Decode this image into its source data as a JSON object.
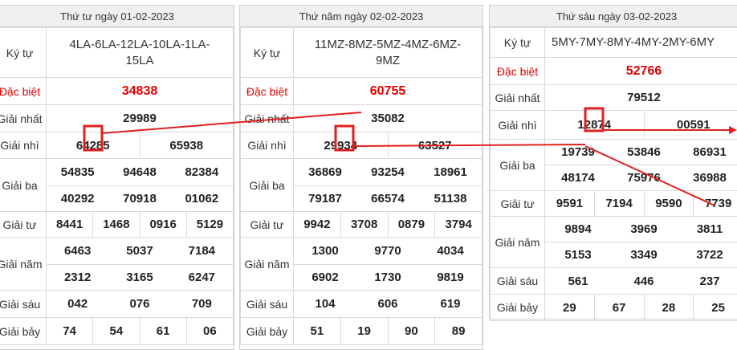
{
  "panels": [
    {
      "header": "Thứ tư ngày 01-02-2023",
      "labels": {
        "kytu": "Ký tự",
        "db": "Đặc biệt",
        "g1": "Giải nhất",
        "g2": "Giải nhì",
        "g3": "Giải ba",
        "g4": "Giải tư",
        "g5": "Giải năm",
        "g6": "Giải sáu",
        "g7": "Giải bảy"
      },
      "kytu": "4LA-6LA-12LA-10LA-1LA-15LA",
      "db": "34838",
      "g1": "29989",
      "g2": [
        "64285",
        "65938"
      ],
      "g3": [
        "54835",
        "94648",
        "82384",
        "40292",
        "70918",
        "01062"
      ],
      "g4": [
        "8441",
        "1468",
        "0916",
        "5129"
      ],
      "g5": [
        "6463",
        "5037",
        "7184",
        "2312",
        "3165",
        "6247"
      ],
      "g6": [
        "042",
        "076",
        "709"
      ],
      "g7": [
        "74",
        "54",
        "61",
        "06"
      ]
    },
    {
      "header": "Thứ năm ngày 02-02-2023",
      "labels": {
        "kytu": "Ký tự",
        "db": "Đặc biệt",
        "g1": "Giải nhất",
        "g2": "Giải nhì",
        "g3": "Giải ba",
        "g4": "Giải tư",
        "g5": "Giải năm",
        "g6": "Giải sáu",
        "g7": "Giải bảy"
      },
      "kytu": "11MZ-8MZ-5MZ-4MZ-6MZ-9MZ",
      "db": "60755",
      "g1": "35082",
      "g2": [
        "29934",
        "63527"
      ],
      "g3": [
        "36869",
        "93254",
        "18961",
        "79187",
        "66574",
        "51138"
      ],
      "g4": [
        "9942",
        "3708",
        "0879",
        "3794"
      ],
      "g5": [
        "1300",
        "9770",
        "4034",
        "6902",
        "1730",
        "9819"
      ],
      "g6": [
        "104",
        "606",
        "619"
      ],
      "g7": [
        "51",
        "19",
        "90",
        "89"
      ]
    },
    {
      "header": "Thứ sáu ngày 03-02-2023",
      "labels": {
        "kytu": "Ký tự",
        "db": "Đặc biệt",
        "g1": "Giải nhất",
        "g2": "Giải nhì",
        "g3": "Giải ba",
        "g4": "Giải tư",
        "g5": "Giải năm",
        "g6": "Giải sáu",
        "g7": "Giải bảy"
      },
      "kytu": "5MY-7MY-8MY-4MY-2MY-6MY",
      "db": "52766",
      "g1": "79512",
      "g2": [
        "12874",
        "00591"
      ],
      "g3": [
        "19739",
        "53846",
        "86931",
        "48174",
        "75976",
        "36988"
      ],
      "g4": [
        "9591",
        "7194",
        "9590",
        "7739"
      ],
      "g5": [
        "9894",
        "3969",
        "3811",
        "5153",
        "3349",
        "3722"
      ],
      "g6": [
        "561",
        "446",
        "237"
      ],
      "g7": [
        "29",
        "67",
        "28",
        "25"
      ]
    }
  ],
  "colors": {
    "accent": "#e00000",
    "annotation": "#e02020",
    "header_bg": "#f0f0f0"
  }
}
